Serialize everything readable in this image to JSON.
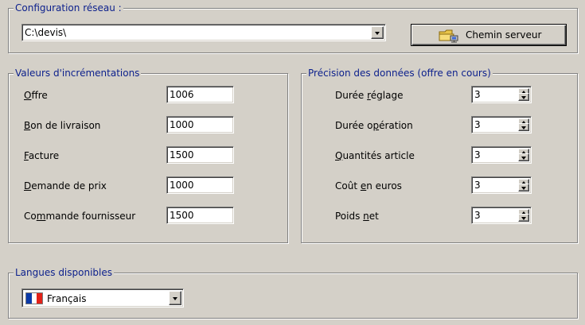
{
  "network": {
    "legend": "Configuration réseau :",
    "path_value": "C:\\devis\\",
    "server_button": "Chemin serveur"
  },
  "increments": {
    "legend": "Valeurs d'incrémentations",
    "rows": [
      {
        "label": "Offre",
        "accel": "O",
        "rest": "ffre",
        "value": "1006"
      },
      {
        "label": "Bon de livraison",
        "accel": "B",
        "rest": "on de livraison",
        "value": "1000"
      },
      {
        "label": "Facture",
        "accel": "F",
        "rest": "acture",
        "value": "1500"
      },
      {
        "label": "Demande de prix",
        "accel": "D",
        "rest": "emande de prix",
        "value": "1000"
      },
      {
        "label": "Commande fournisseur",
        "pre": "Co",
        "accel": "m",
        "rest": "mande fournisseur",
        "value": "1500"
      }
    ]
  },
  "precision": {
    "legend": "Précision des données (offre en cours)",
    "rows": [
      {
        "label": "Durée réglage",
        "pre": "Durée ",
        "accel": "r",
        "rest": "églage",
        "value": "3"
      },
      {
        "label": "Durée opération",
        "pre": "Durée o",
        "accel": "p",
        "rest": "ération",
        "value": "3"
      },
      {
        "label": "Quantités article",
        "pre": "",
        "accel": "Q",
        "rest": "uantités article",
        "value": "3"
      },
      {
        "label": "Coût en euros",
        "pre": "Coût ",
        "accel": "e",
        "rest": "n euros",
        "value": "3"
      },
      {
        "label": "Poids net",
        "pre": "Poids ",
        "accel": "n",
        "rest": "et",
        "value": "3"
      }
    ]
  },
  "languages": {
    "legend": "Langues disponibles",
    "selected": "Français",
    "flag_colors": [
      "#0b3aa8",
      "#ffffff",
      "#e32219"
    ]
  }
}
